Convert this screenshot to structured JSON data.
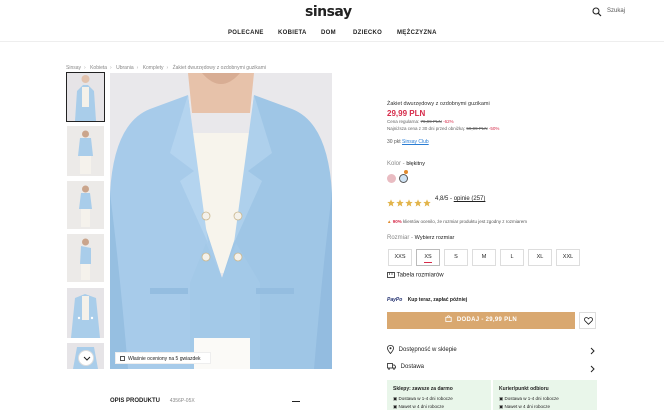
{
  "header": {
    "logo": "sinsay",
    "search_placeholder": "Szukaj",
    "nav": [
      "POLECANE",
      "KOBIETA",
      "DOM",
      "DZIECKO",
      "MĘŻCZYZNA"
    ]
  },
  "breadcrumb": [
    "Sinsay",
    "Kobieta",
    "Ubrania",
    "Komplety",
    "Żakiet dwurzędowy z ozdobnymi guzikami"
  ],
  "gallery": {
    "badge": "Właśnie oceniony na 5 gwiazdek"
  },
  "product": {
    "name": "Żakiet dwurzędowy z ozdobnymi guzikami",
    "price": "29,99 PLN",
    "regular_label": "Cena regularna:",
    "regular_price": "79,99 PLN",
    "regular_discount": "-62%",
    "lowest_label": "Najniższa cena z 30 dni przed obniżką:",
    "lowest_price": "59,99 PLN",
    "lowest_discount": "-50%",
    "club_points": "30 pkt",
    "club_link": "Sinsay Club",
    "color_label": "Kolor - ",
    "color_value": "błękitny",
    "rating": "4,8/5",
    "rating_sep": " - ",
    "reviews": "opinie (257)",
    "fit_percent": "90%",
    "fit_text": " klientów ocenilo, że rozmiar produktu jest zgodny z rozmiarem",
    "size_label": "Rozmiar - ",
    "size_value": "Wybierz rozmiar",
    "sizes": [
      "XXS",
      "XS",
      "S",
      "M",
      "L",
      "XL",
      "XXL"
    ],
    "size_table": "Tabela rozmiarów",
    "paypo_logo": "PayPo",
    "paypo_text": "Kup teraz, zapłać później",
    "add_button": "DODAJ - 29,99 PLN",
    "availability": "Dostępność w sklepie",
    "delivery": "Dostawa",
    "delivery_store_title": "Sklepy: zawsze za darmo",
    "delivery_store_lines": [
      "Dostawa w 1-4 dni robocze",
      "Nawet w 4 dni robocze"
    ],
    "delivery_courier_title": "Kurier/punkt odbioru",
    "delivery_courier_lines": [
      "Dostawa w 1-4 dni robocze",
      "Nawet w 4 dni robocze"
    ]
  },
  "description": {
    "label": "OPIS PRODUKTU",
    "code": "4356P-05X"
  },
  "colors": {
    "accent": "#d62b4a",
    "button": "#d9a870",
    "star": "#e2b44b"
  }
}
